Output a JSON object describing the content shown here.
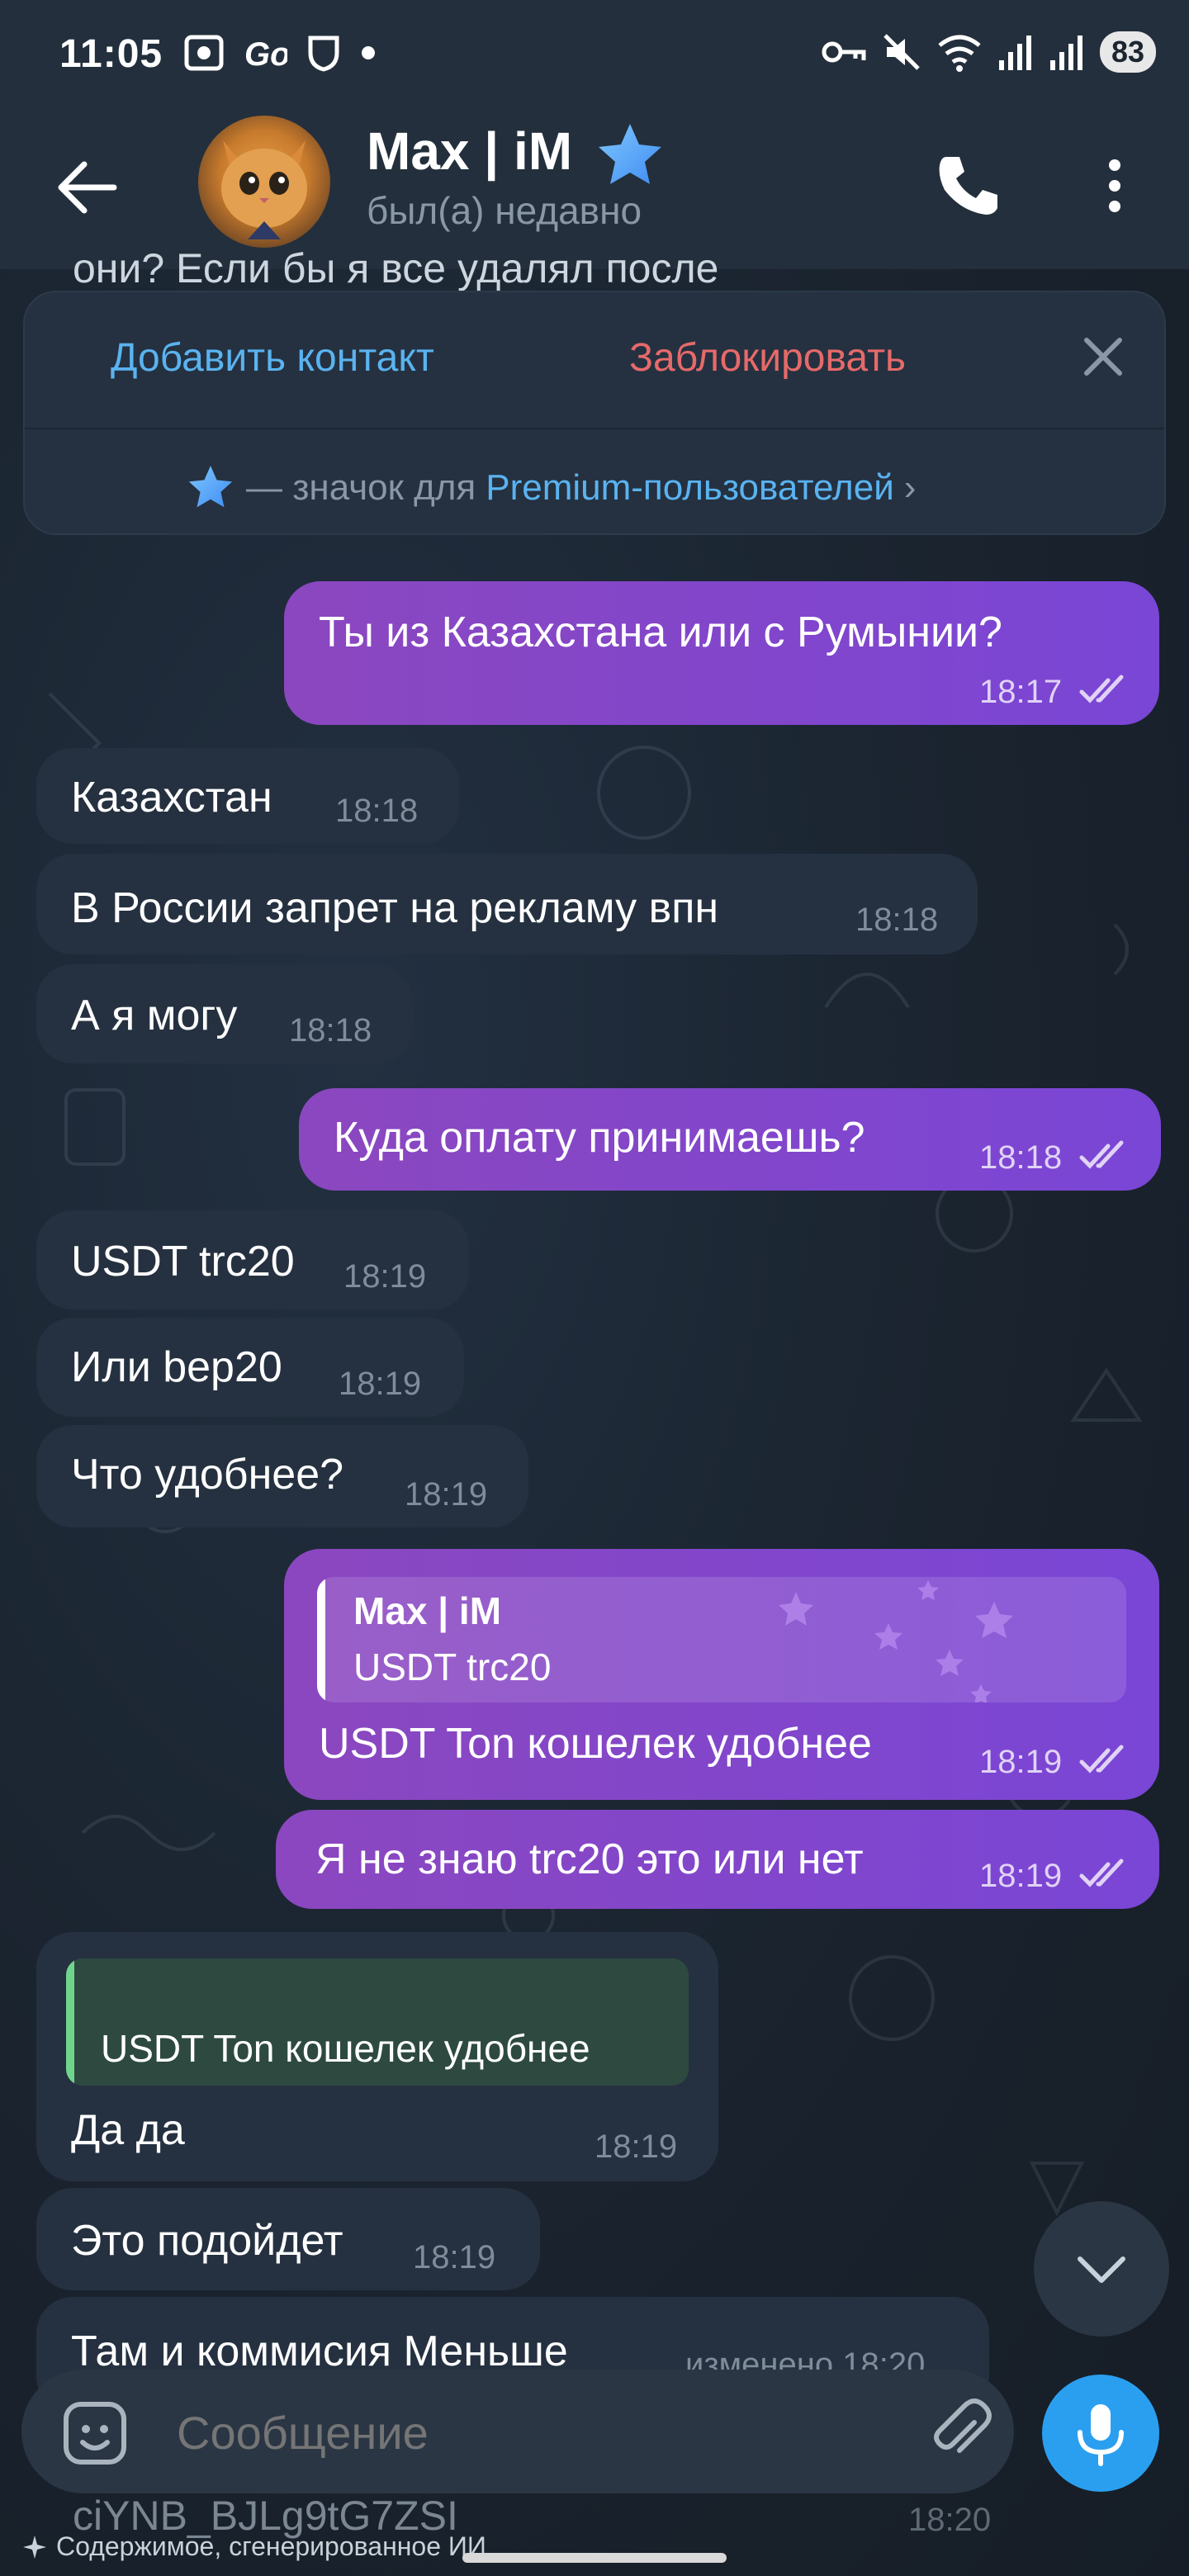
{
  "status_bar": {
    "time": "11:05",
    "battery": "83",
    "icons": [
      "screenshot-icon",
      "go-icon",
      "shield-icon",
      "dot-icon",
      "key-icon",
      "mute-icon",
      "wifi-icon",
      "signal-icon",
      "signal-icon"
    ]
  },
  "header": {
    "name": "Max | iM",
    "status": "был(а) недавно"
  },
  "peek_top_text": "они? Если бы я все удалял после",
  "action_panel": {
    "add_contact": "Добавить контакт",
    "block": "Заблокировать",
    "premium_prefix": "— значок для",
    "premium_link": "Premium-пользователей",
    "chevron": "›"
  },
  "messages": [
    {
      "dir": "out",
      "text": "Ты из Казахстана или с Румынии?",
      "time": "18:17"
    },
    {
      "dir": "in",
      "text": "Казахстан",
      "time": "18:18"
    },
    {
      "dir": "in",
      "text": "В России запрет на рекламу впн",
      "time": "18:18"
    },
    {
      "dir": "in",
      "text": "А я могу",
      "time": "18:18"
    },
    {
      "dir": "out",
      "text": "Куда оплату принимаешь?",
      "time": "18:18"
    },
    {
      "dir": "in",
      "text": "USDT trc20",
      "time": "18:19"
    },
    {
      "dir": "in",
      "text": "Или bep20",
      "time": "18:19"
    },
    {
      "dir": "in",
      "text": "Что удобнее?",
      "time": "18:19"
    },
    {
      "dir": "out",
      "reply_name": "Max | iM",
      "reply_text": "USDT trc20",
      "text": "USDT Ton кошелек удобнее",
      "time": "18:19"
    },
    {
      "dir": "out",
      "text": "Я не знаю trc20 это или нет",
      "time": "18:19"
    },
    {
      "dir": "in",
      "reply_text": "USDT Ton кошелек удобнее",
      "text": "Да да",
      "time": "18:19"
    },
    {
      "dir": "in",
      "text": "Это подойдет",
      "time": "18:19"
    },
    {
      "dir": "in",
      "text": "Там и коммисия Меньше",
      "time": "изменено 18:20"
    }
  ],
  "composer": {
    "placeholder": "Сообщение"
  },
  "bottom_peek": {
    "text": "ciYNB_BJLg9tG7ZSI",
    "time": "18:20"
  },
  "ai_note": "Содержимое, сгенерированное ИИ",
  "colors": {
    "background": "#1c2630",
    "header": "#232f3c",
    "incoming_bubble": "#253140",
    "outgoing_bubble": "#8b47bf",
    "link_blue": "#5ab3f0",
    "block_red": "#e66a6a",
    "mic_button": "#2a9ff0"
  }
}
